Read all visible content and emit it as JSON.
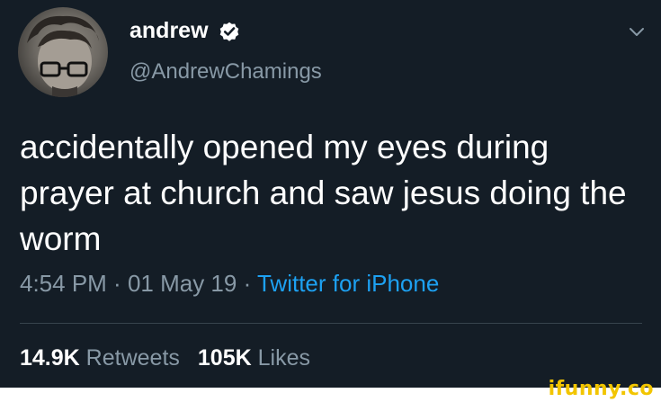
{
  "author": {
    "display_name": "andrew",
    "handle": "@AndrewChamings",
    "verified_icon": "verified-badge-icon",
    "avatar_icon": "profile-photo"
  },
  "menu_icon": "chevron-down-icon",
  "tweet": {
    "text": "accidentally opened my eyes during prayer at church and saw jesus doing the worm"
  },
  "meta": {
    "time": "4:54 PM",
    "separator": " · ",
    "date": "01 May 19",
    "source": "Twitter for iPhone"
  },
  "stats": {
    "retweets_count": "14.9K",
    "retweets_label": "Retweets",
    "likes_count": "105K",
    "likes_label": "Likes"
  },
  "watermark": {
    "text": "ifunny.co"
  },
  "colors": {
    "background": "#141d26",
    "primary_text": "#ffffff",
    "secondary_text": "#8899a6",
    "link": "#1da1f2",
    "watermark": "#f2c500"
  }
}
